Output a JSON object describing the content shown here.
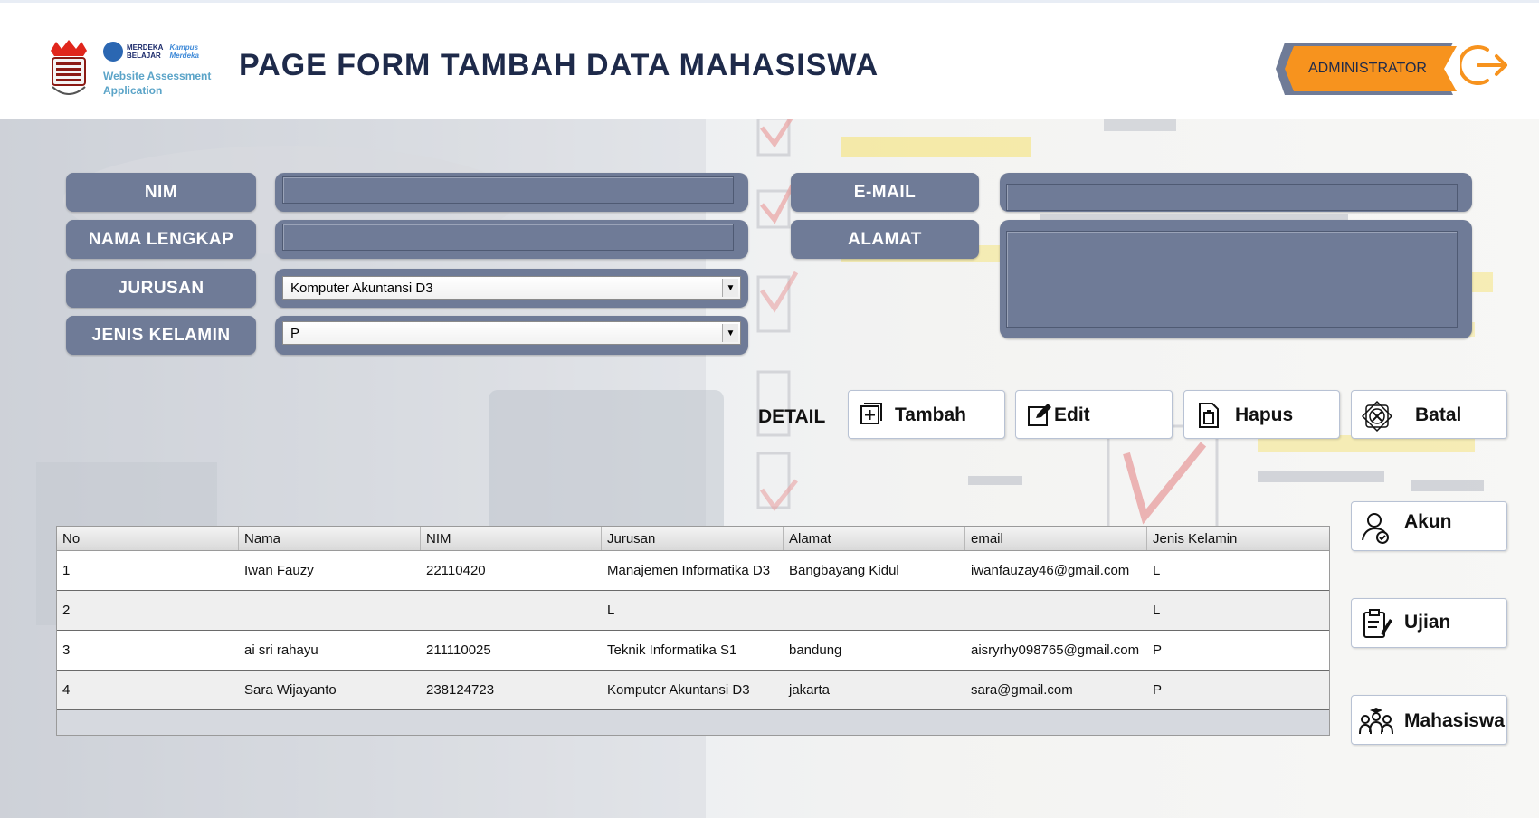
{
  "header": {
    "title": "PAGE FORM TAMBAH DATA MAHASISWA",
    "app_name_line1": "Website Assessment",
    "app_name_line2": "Application",
    "logo_merdeka": "MERDEKA",
    "logo_belajar": "BELAJAR",
    "logo_kampus": "Kampus",
    "logo_merdeka2": "Merdeka",
    "user_role": "ADMINISTRATOR",
    "colors": {
      "badge": "#f7931e",
      "title": "#1e2a4a",
      "logout": "#f7931e"
    }
  },
  "form": {
    "nim_label": "NIM",
    "nama_label": "NAMA LENGKAP",
    "jurusan_label": "JURUSAN",
    "jenis_kelamin_label": "JENIS KELAMIN",
    "email_label": "E-MAIL",
    "alamat_label": "ALAMAT",
    "nim_value": "",
    "nama_value": "",
    "email_value": "",
    "alamat_value": "",
    "jurusan_selected": "Komputer Akuntansi D3",
    "jenis_kelamin_selected": "P",
    "label_color": "#6f7b97"
  },
  "actions": {
    "detail_label": "DETAIL",
    "tambah": "Tambah",
    "edit": "Edit",
    "hapus": "Hapus",
    "batal": "Batal"
  },
  "side_nav": {
    "akun": "Akun",
    "ujian": "Ujian",
    "mahasiswa": "Mahasiswa"
  },
  "table": {
    "columns": [
      "No",
      "Nama",
      "NIM",
      "Jurusan",
      "Alamat",
      "email",
      "Jenis Kelamin"
    ],
    "rows": [
      [
        "1",
        "Iwan Fauzy",
        "22110420",
        "Manajemen Informatika D3",
        "Bangbayang Kidul",
        "iwanfauzay46@gmail.com",
        "L"
      ],
      [
        "2",
        "",
        "",
        "L",
        "",
        "",
        "L"
      ],
      [
        "3",
        "ai sri rahayu",
        "211110025",
        "Teknik Informatika S1",
        "bandung",
        "aisryrhy098765@gmail.com",
        "P"
      ],
      [
        "4",
        "Sara Wijayanto",
        "238124723",
        "Komputer Akuntansi D3",
        "jakarta",
        "sara@gmail.com",
        "P"
      ]
    ]
  }
}
